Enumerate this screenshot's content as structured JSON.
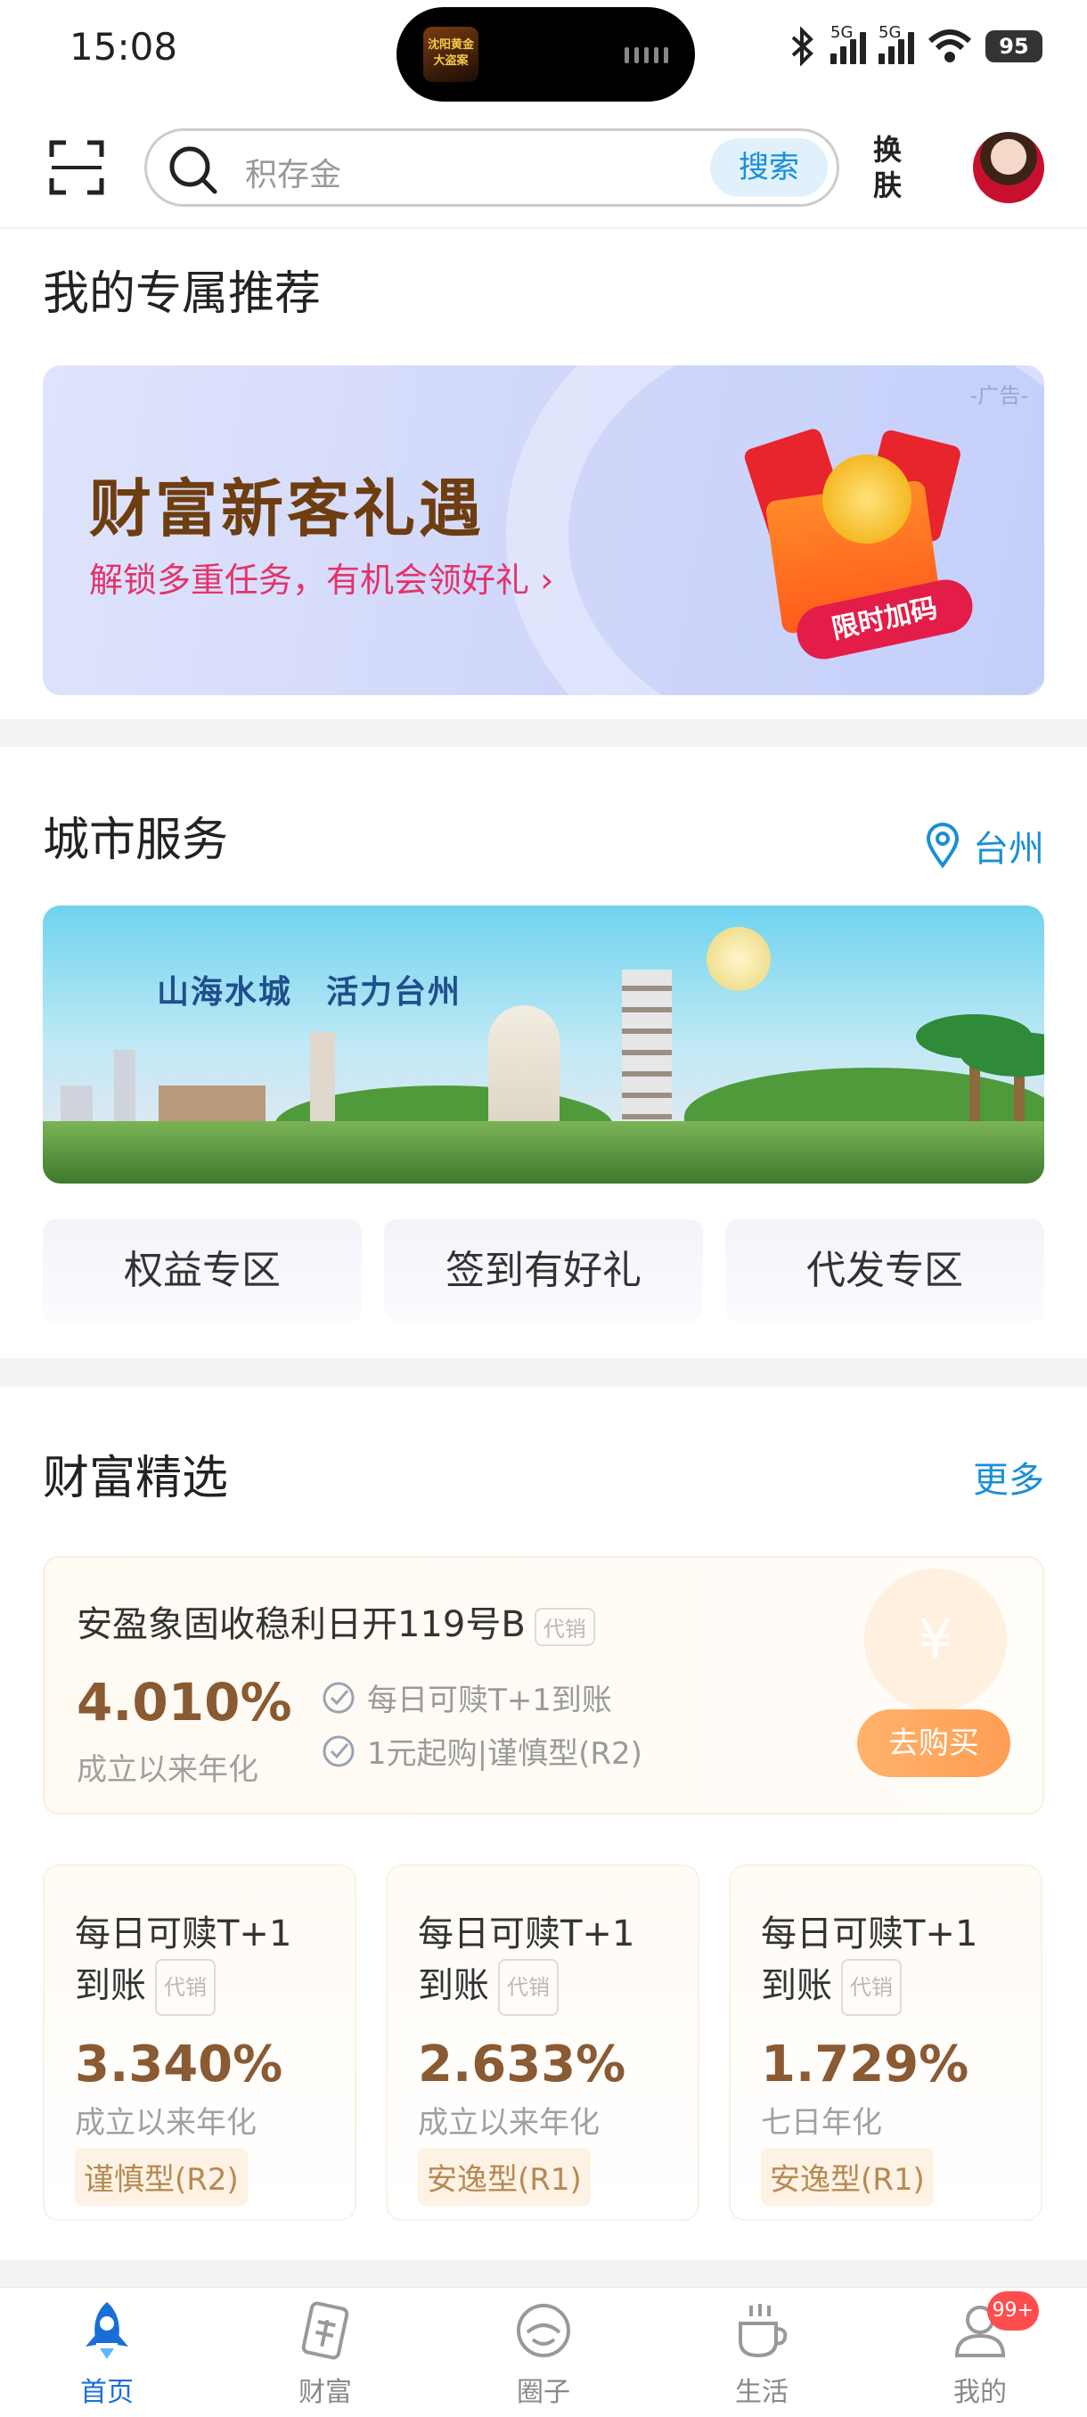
{
  "status_bar": {
    "time": "15:08",
    "island_app": "沈阳黄金大盗案",
    "net1": "5G",
    "net2": "5G",
    "battery": "95"
  },
  "header": {
    "search_placeholder": "积存金",
    "search_button": "搜索",
    "skin_top": "换",
    "skin_bottom": "肤"
  },
  "recommend": {
    "title": "我的专属推荐",
    "ad_tag": "-广告-",
    "banner_title": "财富新客礼遇",
    "banner_sub": "解锁多重任务，有机会领好礼 ›",
    "banner_tag": "限时加码"
  },
  "city": {
    "title": "城市服务",
    "location": "台州",
    "banner_text": "山海水城　活力台州",
    "buttons": [
      "权益专区",
      "签到有好礼",
      "代发专区"
    ]
  },
  "wealth": {
    "title": "财富精选",
    "more": "更多",
    "hero": {
      "name": "安盈象固收稳利日开119号B",
      "badge": "代销",
      "rate": "4.010%",
      "rate_label": "成立以来年化",
      "features": [
        "每日可赎T+1到账",
        "1元起购|谨慎型(R2)"
      ],
      "buy": "去购买"
    },
    "products": [
      {
        "name_l1": "每日可赎T+1",
        "name_l2": "到账",
        "badge": "代销",
        "rate": "3.340%",
        "rate_label": "成立以来年化",
        "risk": "谨慎型(R2)"
      },
      {
        "name_l1": "每日可赎T+1",
        "name_l2": "到账",
        "badge": "代销",
        "rate": "2.633%",
        "rate_label": "成立以来年化",
        "risk": "安逸型(R1)"
      },
      {
        "name_l1": "每日可赎T+1",
        "name_l2": "到账",
        "badge": "代销",
        "rate": "1.729%",
        "rate_label": "七日年化",
        "risk": "安逸型(R1)"
      }
    ]
  },
  "nav": {
    "items": [
      "首页",
      "财富",
      "圈子",
      "生活",
      "我的"
    ],
    "badge": "99+",
    "active_color": "#1a6fd6"
  }
}
